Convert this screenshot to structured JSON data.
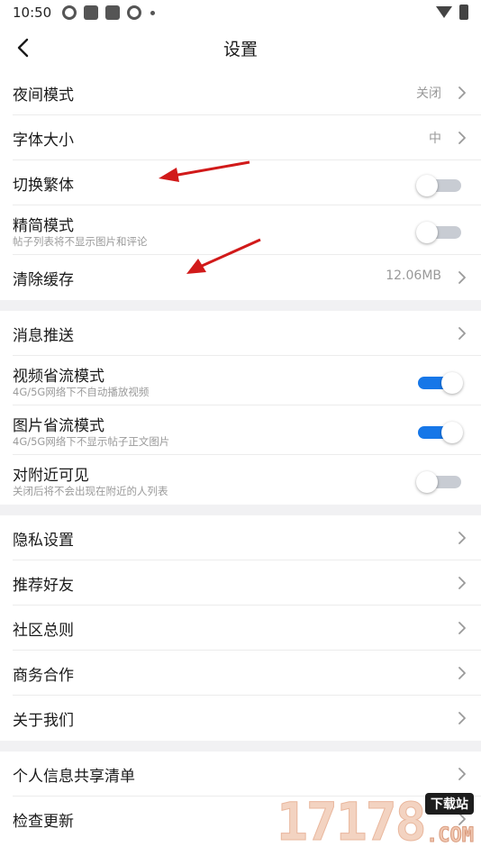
{
  "status_bar": {
    "time": "10:50"
  },
  "header": {
    "title": "设置"
  },
  "groups": [
    {
      "rows": [
        {
          "label": "夜间模式",
          "value": "关闭"
        },
        {
          "label": "字体大小",
          "value": "中"
        },
        {
          "label": "切换繁体",
          "toggle": false
        },
        {
          "label": "精简模式",
          "sub": "帖子列表将不显示图片和评论",
          "toggle": false
        },
        {
          "label": "清除缓存",
          "value": "12.06MB"
        }
      ]
    },
    {
      "rows": [
        {
          "label": "消息推送"
        },
        {
          "label": "视频省流模式",
          "sub": "4G/5G网络下不自动播放视频",
          "toggle": true
        },
        {
          "label": "图片省流模式",
          "sub": "4G/5G网络下不显示帖子正文图片",
          "toggle": true
        },
        {
          "label": "对附近可见",
          "sub": "关闭后将不会出现在附近的人列表",
          "toggle": false
        }
      ]
    },
    {
      "rows": [
        {
          "label": "隐私设置"
        },
        {
          "label": "推荐好友"
        },
        {
          "label": "社区总则"
        },
        {
          "label": "商务合作"
        },
        {
          "label": "关于我们"
        }
      ]
    },
    {
      "rows": [
        {
          "label": "个人信息共享清单"
        },
        {
          "label": "检查更新"
        }
      ]
    }
  ],
  "watermark": {
    "digits": "17178",
    "badge": "下载站",
    "domain": ".COM"
  },
  "colors": {
    "accent": "#1677e8",
    "toggle_off": "#c8ccd3",
    "annotation_arrow": "#d11a1a"
  }
}
